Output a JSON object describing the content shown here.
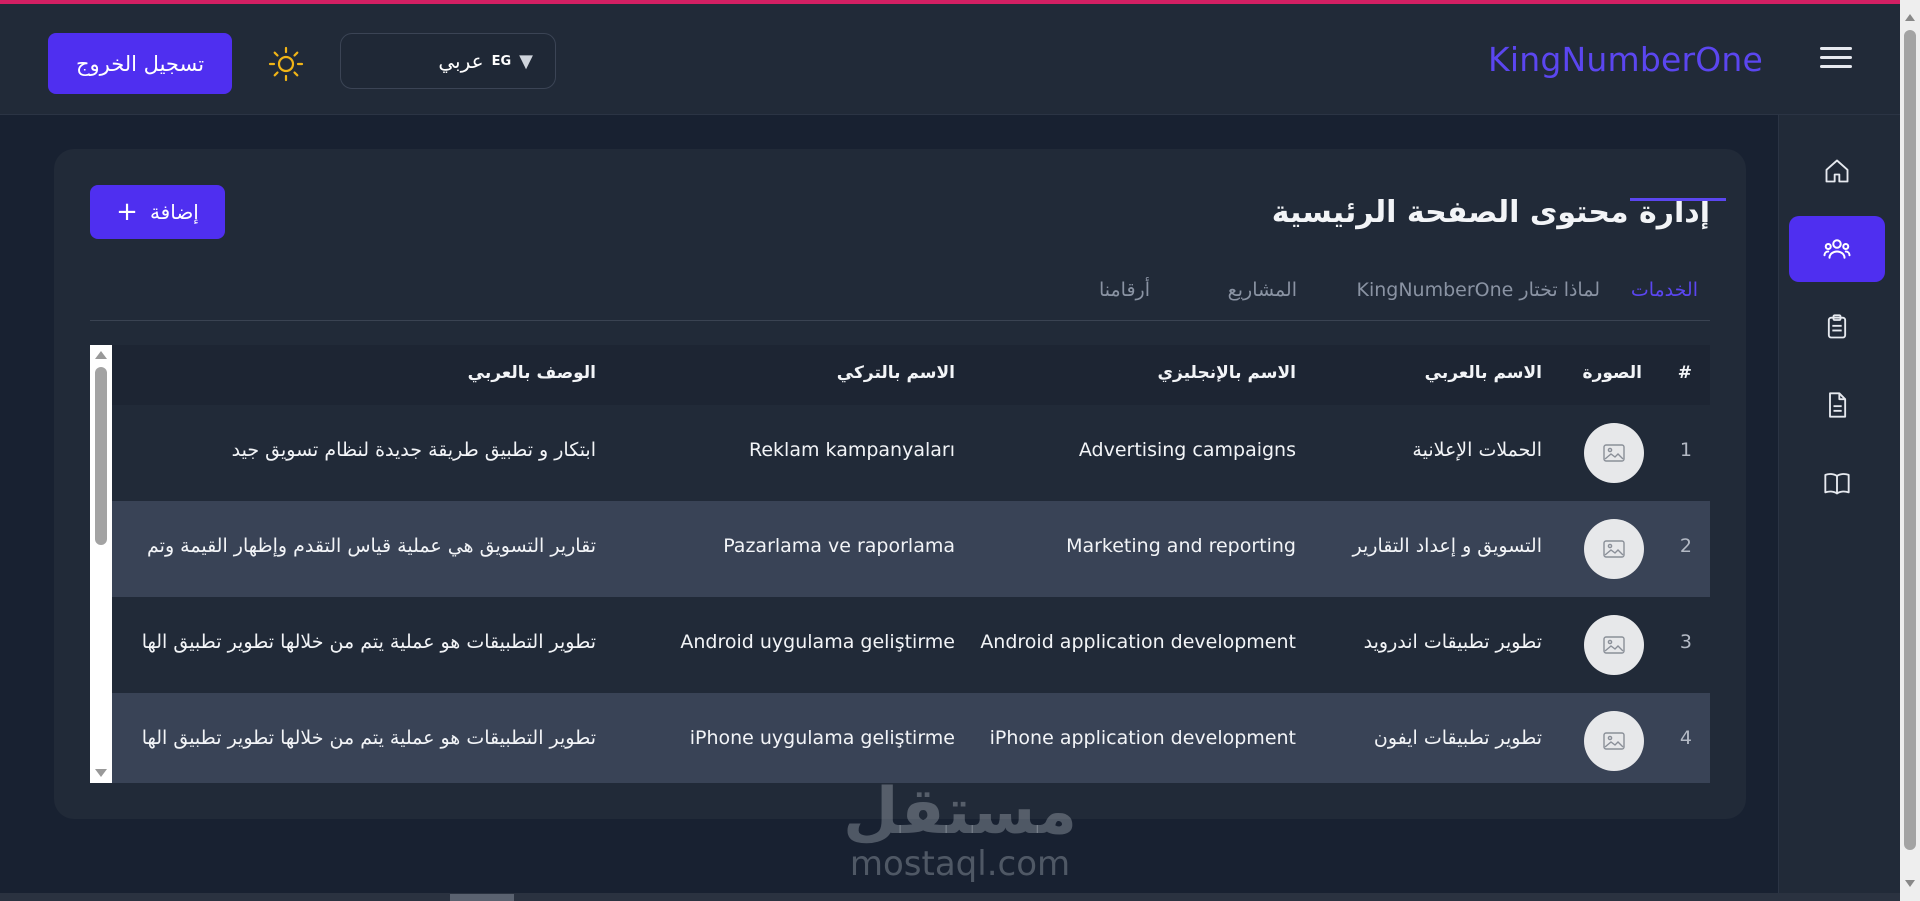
{
  "header": {
    "logo": "KingNumberOne",
    "language": {
      "flag": "EG",
      "label": "عربي"
    },
    "logout_label": "تسجيل الخروج"
  },
  "sidebar": {
    "items": [
      {
        "icon": "home-icon",
        "active": false
      },
      {
        "icon": "users-icon",
        "active": true
      },
      {
        "icon": "clipboard-icon",
        "active": false
      },
      {
        "icon": "document-icon",
        "active": false
      },
      {
        "icon": "book-icon",
        "active": false
      }
    ]
  },
  "main": {
    "title": "إدارة محتوى الصفحة الرئيسية",
    "add_label": "إضافة",
    "tabs": [
      {
        "label": "الخدمات",
        "active": true
      },
      {
        "label": "لماذا تختار KingNumberOne",
        "active": false
      },
      {
        "label": "المشاريع",
        "active": false
      },
      {
        "label": "أرقامنا",
        "active": false
      }
    ]
  },
  "table": {
    "columns": [
      "#",
      "الصورة",
      "الاسم بالعربي",
      "الاسم بالإنجليزي",
      "الاسم بالتركي",
      "الوصف بالعربي"
    ],
    "rows": [
      {
        "num": "1",
        "name_ar": "الحملات الإعلانية",
        "name_en": "Advertising campaigns",
        "name_tr": "Reklam kampanyaları",
        "desc_ar": "ابتكار و تطبيق طريقة جديدة لنظام تسويق جيد"
      },
      {
        "num": "2",
        "name_ar": "التسويق و إعداد التقارير",
        "name_en": "Marketing and reporting",
        "name_tr": "Pazarlama ve raporlama",
        "desc_ar": "تقارير التسويق هي عملية قياس التقدم وإظهار القيمة وتم"
      },
      {
        "num": "3",
        "name_ar": "تطوير تطبيقات اندرويد",
        "name_en": "Android application development",
        "name_tr": "Android uygulama geliştirme",
        "desc_ar": "تطوير التطبيقات هو عملية يتم من خلالها تطوير تطبيق الها"
      },
      {
        "num": "4",
        "name_ar": "تطوير تطبيقات ايفون",
        "name_en": "iPhone application development",
        "name_tr": "iPhone uygulama geliştirme",
        "desc_ar": "تطوير التطبيقات هو عملية يتم من خلالها تطوير تطبيق الها"
      }
    ]
  },
  "watermark": {
    "arabic": "مستقل",
    "latin": "mostaql.com"
  },
  "colors": {
    "accent": "#4f2ff0",
    "logo": "#5b46f0",
    "background": "#182131",
    "panel": "#212a38"
  }
}
